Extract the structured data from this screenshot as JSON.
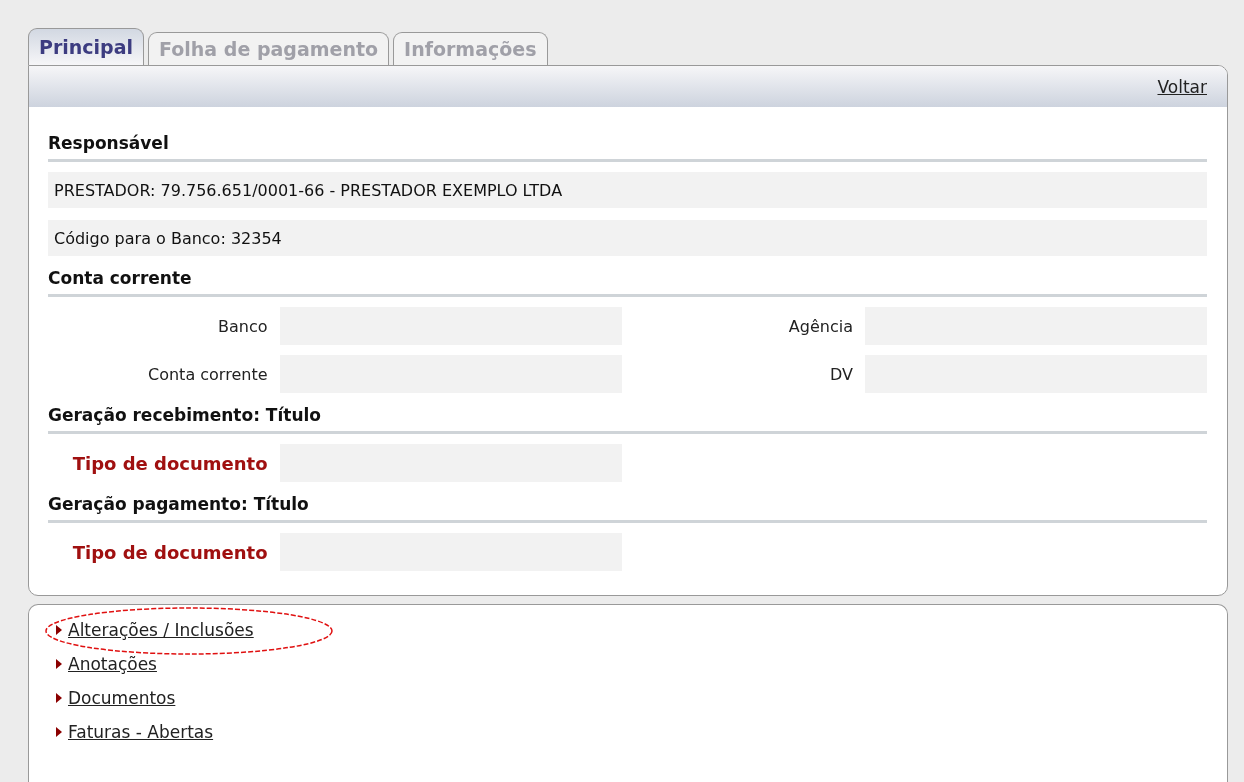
{
  "tabs": [
    {
      "label": "Principal",
      "selected": true
    },
    {
      "label": "Folha de pagamento",
      "selected": false
    },
    {
      "label": "Informações",
      "selected": false
    }
  ],
  "header": {
    "link": "Voltar"
  },
  "sections": [
    {
      "title": "Responsável",
      "kind": "info",
      "rows": [
        "PRESTADOR: 79.756.651/0001-66 - PRESTADOR EXEMPLO LTDA",
        "Código para o Banco: 32354"
      ]
    },
    {
      "title": "Conta corrente",
      "kind": "fields",
      "fields": [
        {
          "label": "Banco",
          "required": false
        },
        {
          "label": "Agência",
          "required": false
        },
        {
          "label": "Conta corrente",
          "required": false
        },
        {
          "label": "DV",
          "required": false
        }
      ]
    },
    {
      "title": "Geração recebimento: Título",
      "kind": "fields",
      "fields": [
        {
          "label": "Tipo de documento",
          "required": true
        }
      ]
    },
    {
      "title": "Geração pagamento: Título",
      "kind": "fields",
      "fields": [
        {
          "label": "Tipo de documento",
          "required": true
        }
      ]
    }
  ],
  "links": [
    {
      "label": "Alterações / Inclusões",
      "circled": true
    },
    {
      "label": "Anotações",
      "circled": false
    },
    {
      "label": "Documentos",
      "circled": false
    },
    {
      "label": "Faturas - Abertas",
      "circled": false
    }
  ]
}
